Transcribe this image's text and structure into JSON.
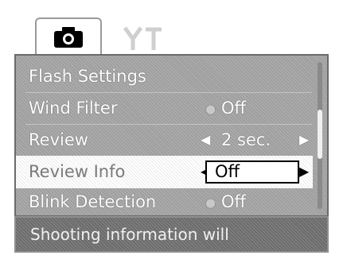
{
  "tabs": [
    {
      "label": "",
      "icon": "camera-icon"
    },
    {
      "label": "YT",
      "icon": "tools-icon"
    }
  ],
  "menu": {
    "items": [
      {
        "label": "Flash Settings",
        "value": "",
        "indicator": ""
      },
      {
        "label": "Wind Filter",
        "value": "Off",
        "indicator": "dot"
      },
      {
        "label": "Review",
        "value": "2 sec.",
        "indicator": "arrows"
      },
      {
        "label": "Review Info",
        "value": "Off",
        "indicator": "selected-arrows"
      },
      {
        "label": "Blink Detection",
        "value": "Off",
        "indicator": "dot"
      }
    ],
    "scroll_position": 0.3
  },
  "info_text": "Shooting information will",
  "colors": {
    "panel": "#9f9f9f",
    "selected_row": "#ffffff",
    "text": "#ffffff",
    "info_bar": "#6c6c6c"
  }
}
